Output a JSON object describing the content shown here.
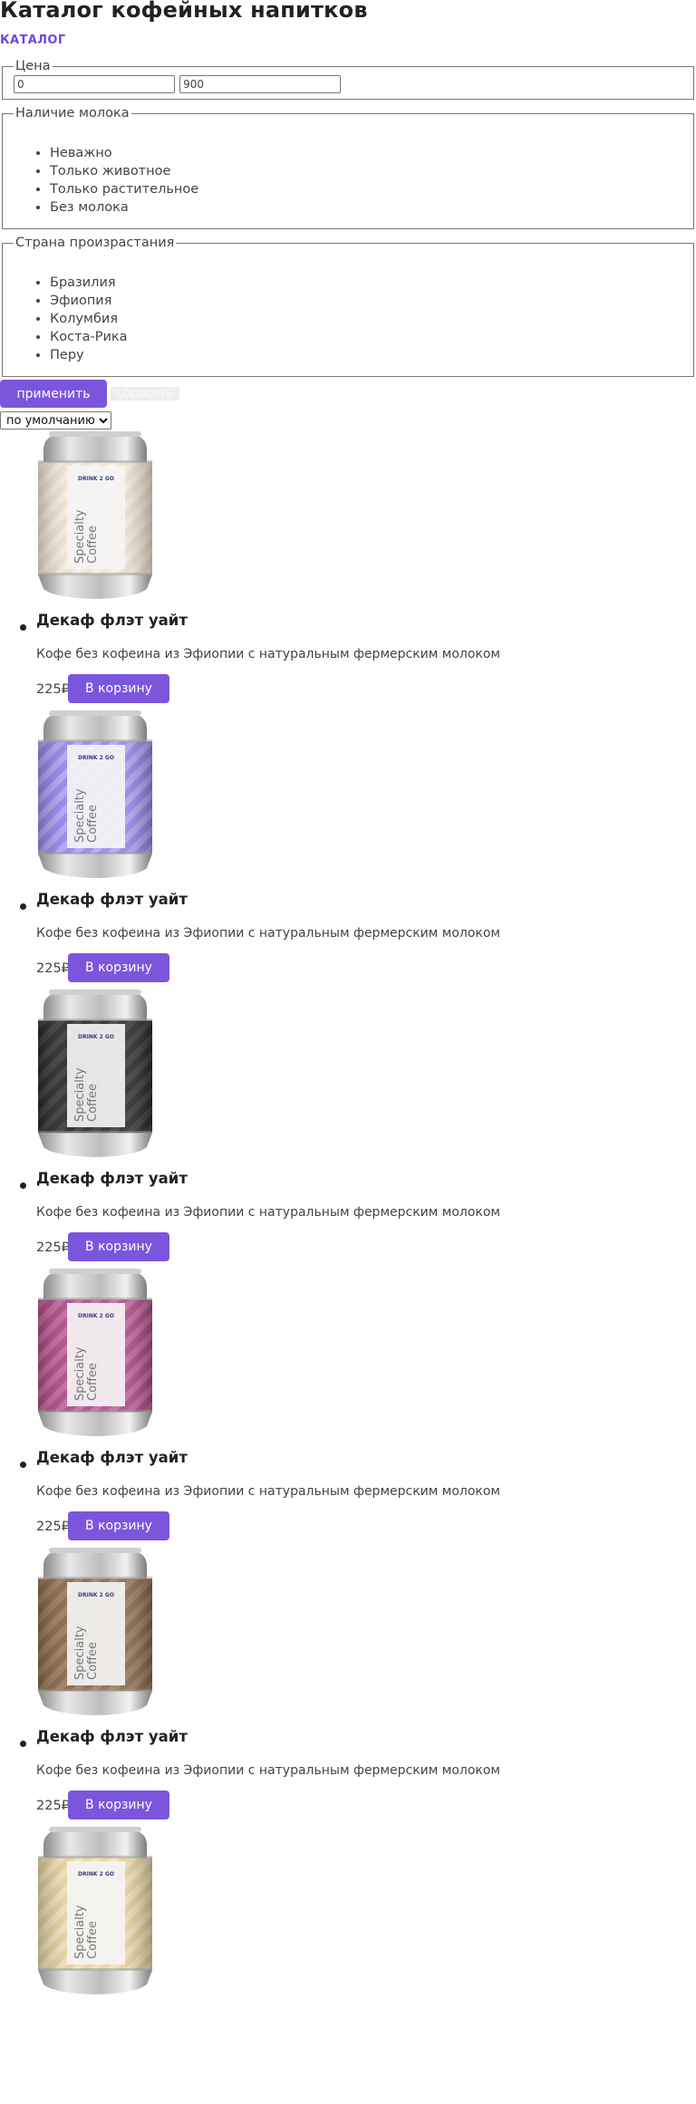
{
  "page_title": "Каталог кофейных напитков",
  "catalog_link": "КАТАЛОГ",
  "filters": {
    "price": {
      "legend": "Цена",
      "min_value": "0",
      "max_value": "900"
    },
    "milk": {
      "legend": "Наличие молока",
      "options": [
        "Неважно",
        "Только животное",
        "Только растительное",
        "Без молока"
      ]
    },
    "country": {
      "legend": "Страна произрастания",
      "options": [
        "Бразилия",
        "Эфиопия",
        "Колумбия",
        "Коста-Рика",
        "Перу"
      ]
    },
    "apply_label": "применить",
    "reset_label": "сбросить"
  },
  "sort": {
    "selected": "по умолчанию"
  },
  "products": [
    {
      "name": "Декаф флэт уайт",
      "description": "Кофе без кофеина из Эфиопии с натуральным фермерским молоком",
      "price": "225₽",
      "cart_label": "В корзину",
      "can_color": "#efe4d0",
      "stripe_color": "#f7efe0"
    },
    {
      "name": "Декаф флэт уайт",
      "description": "Кофе без кофеина из Эфиопии с натуральным фермерским молоком",
      "price": "225₽",
      "cart_label": "В корзину",
      "can_color": "#9a86ee",
      "stripe_color": "#b4a6f5"
    },
    {
      "name": "Декаф флэт уайт",
      "description": "Кофе без кофеина из Эфиопии с натуральным фермерским молоком",
      "price": "225₽",
      "cart_label": "В корзину",
      "can_color": "#2b2b2b",
      "stripe_color": "#3e3e3e"
    },
    {
      "name": "Декаф флэт уайт",
      "description": "Кофе без кофеина из Эфиопии с натуральным фермерским молоком",
      "price": "225₽",
      "cart_label": "В корзину",
      "can_color": "#b04c8a",
      "stripe_color": "#c36a9f"
    },
    {
      "name": "Декаф флэт уайт",
      "description": "Кофе без кофеина из Эфиопии с натуральным фермерским молоком",
      "price": "225₽",
      "cart_label": "В корзину",
      "can_color": "#8a6a4a",
      "stripe_color": "#9c7f62"
    },
    {
      "name": "",
      "description": "",
      "price": "",
      "cart_label": "",
      "can_color": "#e9d3a0",
      "stripe_color": "#f2e2bb"
    }
  ],
  "can_label": {
    "brand": "DRINK 2 GO",
    "line1": "Specialty",
    "line2": "Coffee"
  }
}
